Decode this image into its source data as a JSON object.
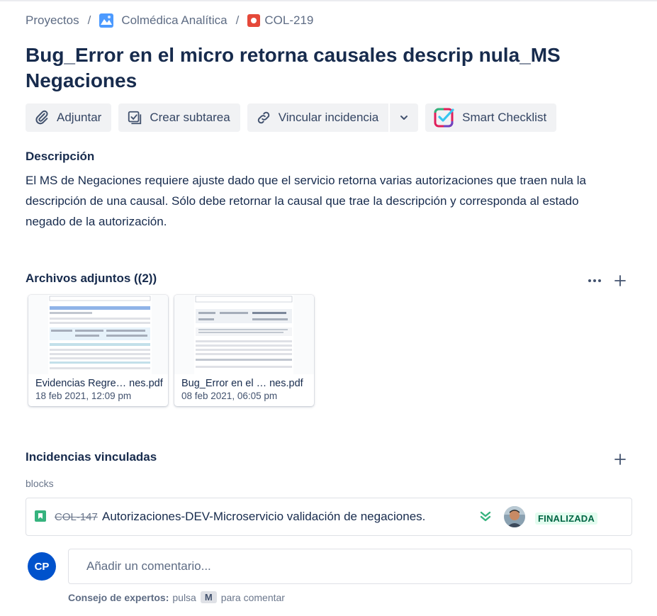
{
  "breadcrumb": {
    "projects": "Proyectos",
    "separator": "/",
    "project": "Colmédica Analítica",
    "issue_key": "COL-219"
  },
  "issue": {
    "title": "Bug_Error en el micro retorna causales descrip nula_MS Negaciones"
  },
  "toolbar": {
    "attach": "Adjuntar",
    "create_subtask": "Crear subtarea",
    "link_issue": "Vincular incidencia",
    "smart_checklist": "Smart Checklist"
  },
  "description": {
    "label": "Descripción",
    "text": "El MS de Negaciones requiere ajuste dado que el servicio retorna varias autorizaciones que traen nula la descripción de una causal. Sólo debe retornar la causal que trae la descripción y corresponda al estado negado de la autorización."
  },
  "attachments": {
    "label": "Archivos adjuntos ((2))",
    "items": [
      {
        "name": "Evidencias Regre… nes.pdf",
        "date": "18 feb 2021, 12:09 pm"
      },
      {
        "name": "Bug_Error en el … nes.pdf",
        "date": "08 feb 2021, 06:05 pm"
      }
    ]
  },
  "linked": {
    "label": "Incidencias vinculadas",
    "relation": "blocks",
    "items": [
      {
        "key": "COL-147",
        "summary": "Autorizaciones-DEV-Microservicio validación de negaciones.",
        "status": "FINALIZADA"
      }
    ]
  },
  "comment": {
    "avatar_initials": "CP",
    "placeholder": "Añadir un comentario...",
    "tip_bold": "Consejo de expertos:",
    "tip_press": "pulsa",
    "tip_key": "M",
    "tip_rest": "para comentar"
  },
  "colors": {
    "primary_text": "#172b4d",
    "button_bg": "#f1f2f4",
    "avatar_bg": "#0052cc",
    "status_done_bg": "#e3fcef",
    "status_done_text": "#006644",
    "issue_type_red": "#e5493a",
    "story_green": "#36b37e"
  },
  "icons": [
    "paperclip-icon",
    "subtask-icon",
    "link-icon",
    "chevron-down-icon",
    "smart-checklist-icon",
    "more-icon",
    "plus-icon",
    "story-icon",
    "priority-lowest-icon",
    "bug-icon",
    "project-icon"
  ]
}
